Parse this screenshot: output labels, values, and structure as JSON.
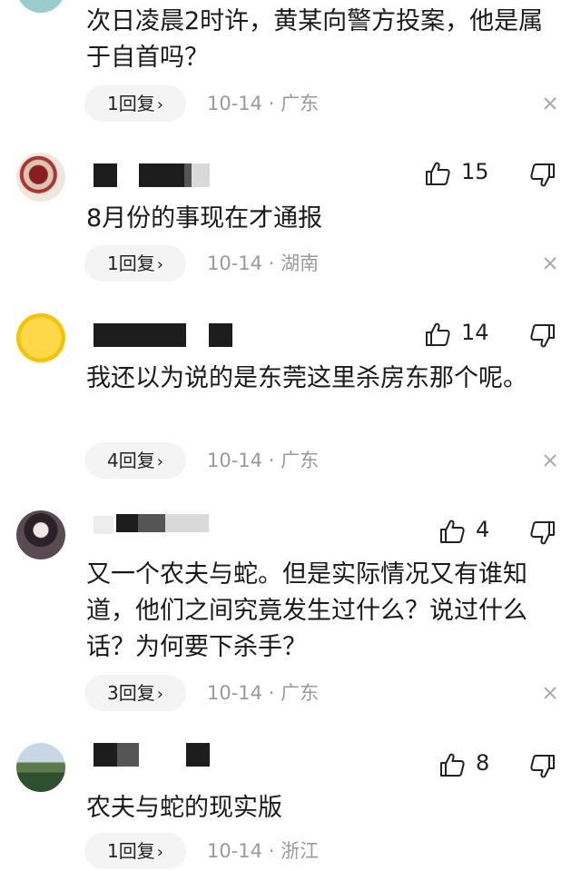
{
  "comments": [
    {
      "text": "次日凌晨2时许，黄某向警方投案，他是属于自首吗？",
      "replies_label": "1回复",
      "date": "10-14",
      "location": "广东"
    },
    {
      "likes": "15",
      "text": "8月份的事现在才通报",
      "replies_label": "1回复",
      "date": "10-14",
      "location": "湖南"
    },
    {
      "likes": "14",
      "text": "我还以为说的是东莞这里杀房东那个呢。",
      "replies_label": "4回复",
      "date": "10-14",
      "location": "广东"
    },
    {
      "likes": "4",
      "text": "又一个农夫与蛇。但是实际情况又有谁知道，他们之间究竟发生过什么？说过什么话？为何要下杀手？",
      "replies_label": "3回复",
      "date": "10-14",
      "location": "广东"
    },
    {
      "likes": "8",
      "text": "农夫与蛇的现实版",
      "replies_label": "1回复",
      "date": "10-14",
      "location": "浙江"
    }
  ],
  "separator": "·",
  "chevron": "›",
  "colors": {
    "meta_gray": "#9a9a9a",
    "pill_bg": "#f4f4f4"
  }
}
